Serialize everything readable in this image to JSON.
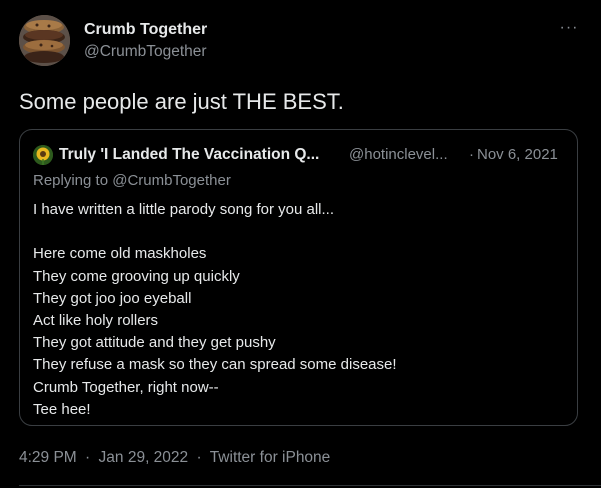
{
  "tweet": {
    "author": {
      "name": "Crumb Together",
      "handle": "@CrumbTogether"
    },
    "text": "Some people are just THE BEST.",
    "more_icon": "more-options-icon",
    "meta": {
      "time": "4:29 PM",
      "sep1": "·",
      "date": "Jan 29, 2022",
      "sep2": "·",
      "source": "Twitter for iPhone"
    }
  },
  "quoted_tweet": {
    "author": {
      "name": "Truly 'I Landed The Vaccination Q...",
      "handle": "@hotinclevel..."
    },
    "sep": "·",
    "date": "Nov 6, 2021",
    "replying_to": "Replying to @CrumbTogether",
    "lines": [
      "I have written a little parody song for you all...",
      "",
      "Here come old maskholes",
      "They come grooving up quickly",
      "They got joo joo eyeball",
      "Act like holy rollers",
      "They got attitude and they get pushy",
      "They refuse a mask so they can spread some disease!",
      "Crumb Together, right now--",
      "Tee hee!"
    ]
  },
  "colors": {
    "background": "#000000",
    "text": "#e7e9ea",
    "secondary": "#8b9096",
    "border": "#3a3e42"
  }
}
